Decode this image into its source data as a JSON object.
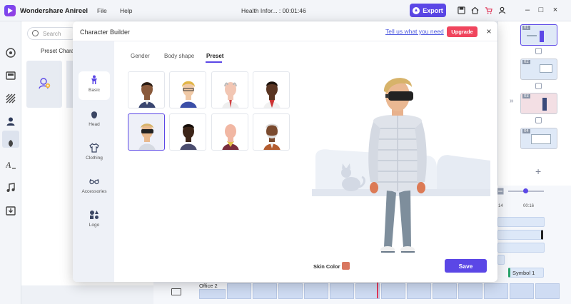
{
  "app": {
    "name": "Wondershare Anireel",
    "menu": [
      "File",
      "Help"
    ],
    "doc_title": "Health Infor... : 00:01:46",
    "export_label": "Export"
  },
  "left_panel": {
    "search_placeholder": "Search",
    "preset_label": "Preset Characte"
  },
  "modal": {
    "title": "Character Builder",
    "tell_link": "Tell us what you need",
    "upgrade_label": "Upgrade",
    "close_label": "×",
    "sidebar": [
      {
        "label": "Basic",
        "icon": "person-icon",
        "active": true
      },
      {
        "label": "Head",
        "icon": "head-icon",
        "active": false
      },
      {
        "label": "Clothing",
        "icon": "shirt-icon",
        "active": false
      },
      {
        "label": "Accessories",
        "icon": "glasses-icon",
        "active": false
      },
      {
        "label": "Logo",
        "icon": "shapes-icon",
        "active": false
      }
    ],
    "tabs": [
      {
        "label": "Gender",
        "active": false
      },
      {
        "label": "Body shape",
        "active": false
      },
      {
        "label": "Preset",
        "active": true
      }
    ],
    "skin_color_label": "Skin Color",
    "skin_color": "#d9775f",
    "save_label": "Save"
  },
  "timeline": {
    "times": [
      "14",
      "00:16"
    ],
    "track_label_1": "Office 2",
    "track_label_2": "Symbol 1"
  },
  "colors": {
    "accent": "#5b47e6",
    "upgrade": "#f0455d",
    "link": "#4f5be0"
  }
}
